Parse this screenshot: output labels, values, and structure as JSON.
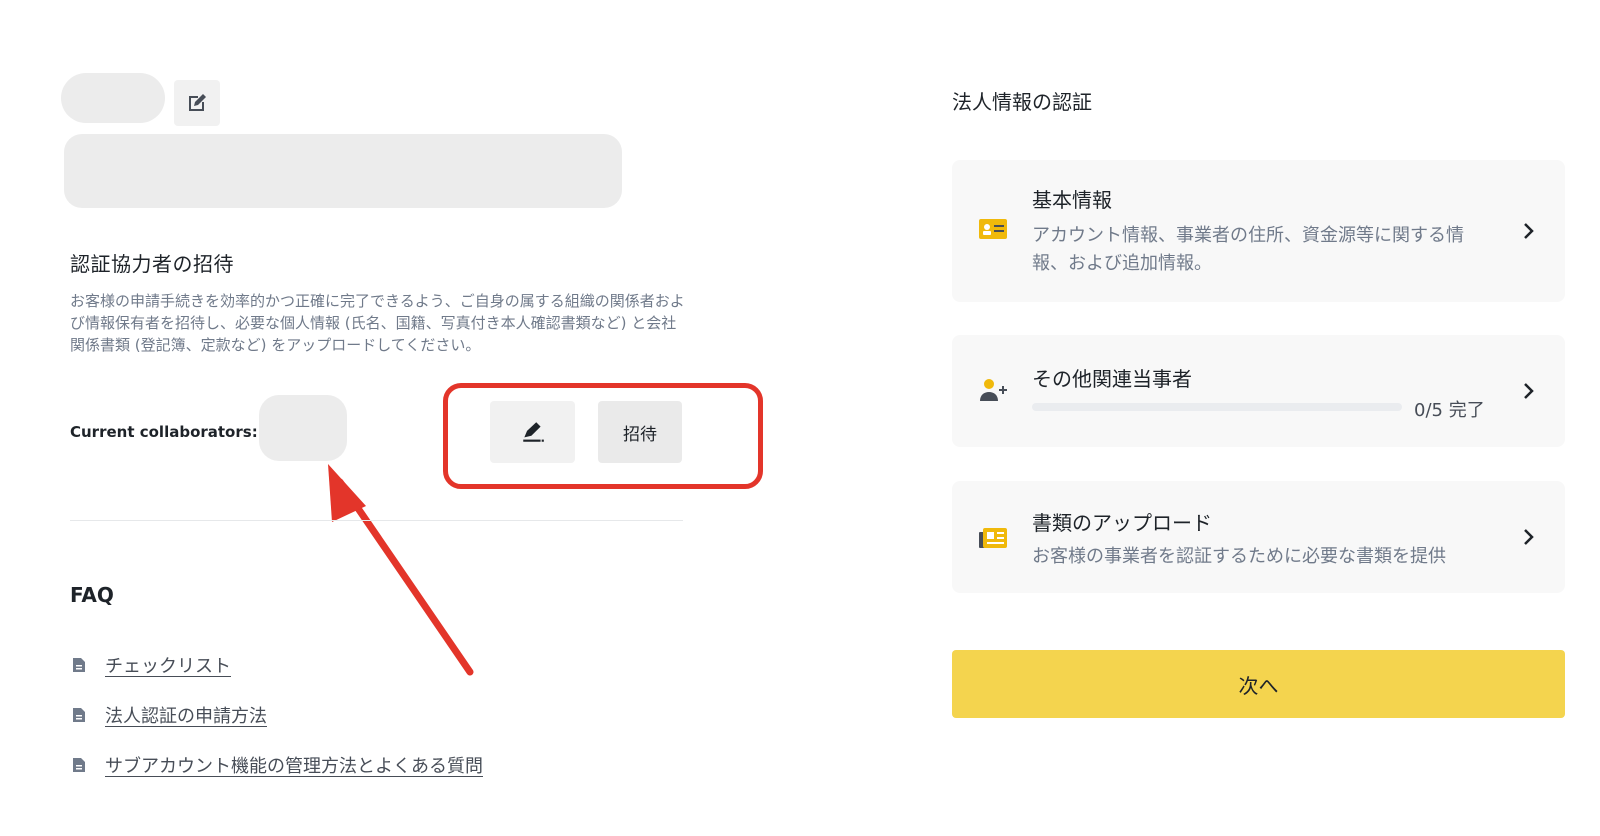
{
  "left": {
    "invite_section": {
      "title": "認証協力者の招待",
      "description": "お客様の申請手続きを効率的かつ正確に完了できるよう、ご自身の属する組織の関係者および情報保有者を招待し、必要な個人情報 (氏名、国籍、写真付き本人確認書類など) と会社関係書類 (登記簿、定款など) をアップロードしてください。",
      "collaborators_label": "Current collaborators:",
      "invite_button_label": "招待"
    },
    "faq": {
      "title": "FAQ",
      "links": [
        {
          "label": "チェックリスト"
        },
        {
          "label": "法人認証の申請方法"
        },
        {
          "label": "サブアカウント機能の管理方法とよくある質問"
        }
      ]
    }
  },
  "right": {
    "title": "法人情報の認証",
    "cards": {
      "basic": {
        "title": "基本情報",
        "description": "アカウント情報、事業者の住所、資金源等に関する情報、および追加情報。"
      },
      "related_parties": {
        "title": "その他関連当事者",
        "progress_fraction": 0,
        "progress_text": "0/5 完了"
      },
      "documents": {
        "title": "書類のアップロード",
        "description": "お客様の事業者を認証するために必要な書類を提供"
      }
    },
    "next_button_label": "次へ"
  },
  "icons": {
    "edit_name": "edit-square-icon",
    "edit_collaborators": "pen-icon",
    "document": "document-icon",
    "id_card": "id-card-icon",
    "add_user": "add-user-icon",
    "document_upload": "newspaper-icon",
    "chevron": "chevron-right-icon"
  },
  "colors": {
    "accent_yellow": "#f4d44e",
    "progress_yellow": "#f0b90b",
    "annotation_red": "#e3352a",
    "card_background": "#f8f8f8"
  }
}
